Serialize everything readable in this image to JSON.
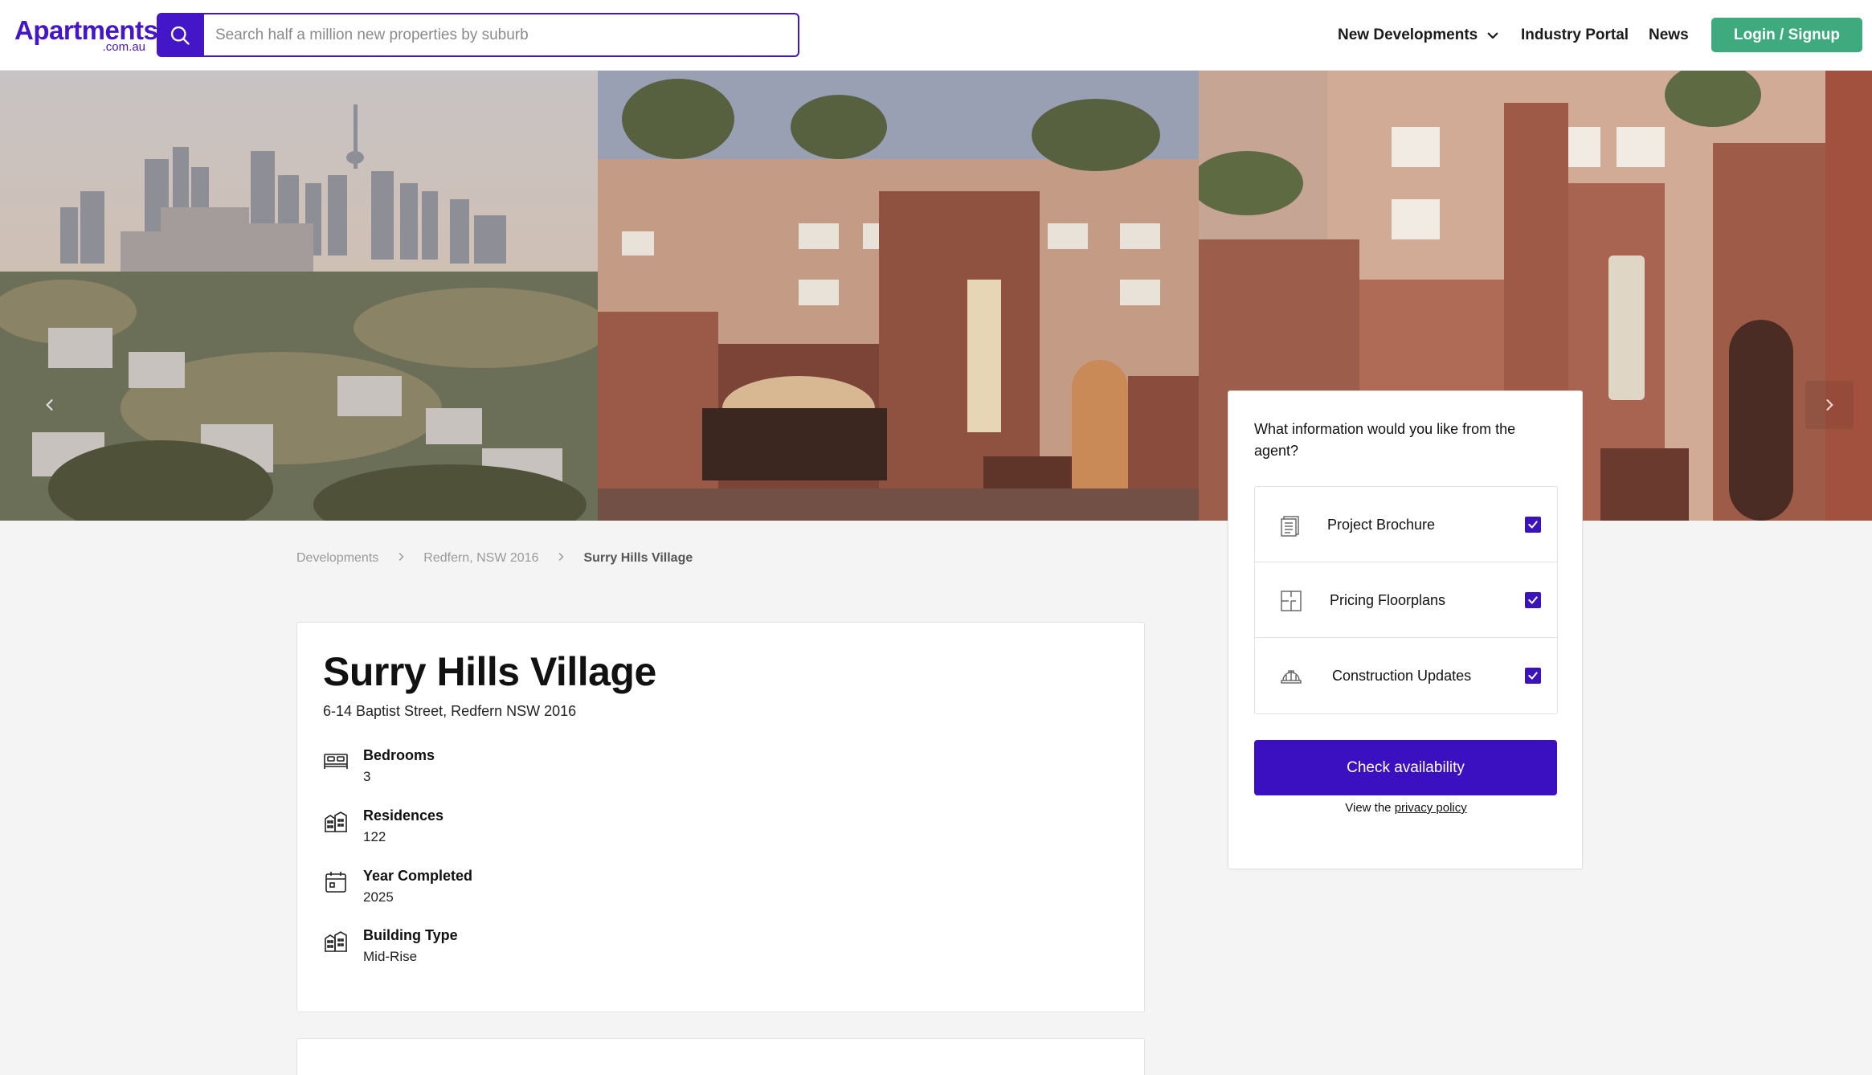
{
  "header": {
    "logo_main": "Apartments",
    "logo_sub": ".com.au",
    "search_placeholder": "Search half a million new properties by suburb",
    "nav": {
      "new_developments": "New Developments",
      "industry_portal": "Industry Portal",
      "news": "News"
    },
    "login_label": "Login / Signup"
  },
  "colors": {
    "brand": "#4316c7",
    "login": "#3faa7e",
    "checkbox": "#3a14b8"
  },
  "breadcrumb": [
    "Developments",
    "Redfern, NSW 2016",
    "Surry Hills Village"
  ],
  "development": {
    "title": "Surry Hills Village",
    "address": "6-14 Baptist Street, Redfern NSW 2016",
    "specs": [
      {
        "icon": "bed-icon",
        "label": "Bedrooms",
        "value": "3"
      },
      {
        "icon": "building-icon",
        "label": "Residences",
        "value": "122"
      },
      {
        "icon": "calendar-icon",
        "label": "Year Completed",
        "value": "2025"
      },
      {
        "icon": "building-icon",
        "label": "Building Type",
        "value": "Mid-Rise"
      }
    ]
  },
  "enquiry": {
    "question": "What information would you like from the agent?",
    "options": [
      {
        "icon": "brochure-icon",
        "label": "Project Brochure",
        "checked": true
      },
      {
        "icon": "floorplan-icon",
        "label": "Pricing Floorplans",
        "checked": true
      },
      {
        "icon": "hard-hat-icon",
        "label": "Construction Updates",
        "checked": true
      }
    ],
    "cta_label": "Check availability",
    "privacy_prefix": "View the",
    "privacy_link": "privacy policy"
  }
}
